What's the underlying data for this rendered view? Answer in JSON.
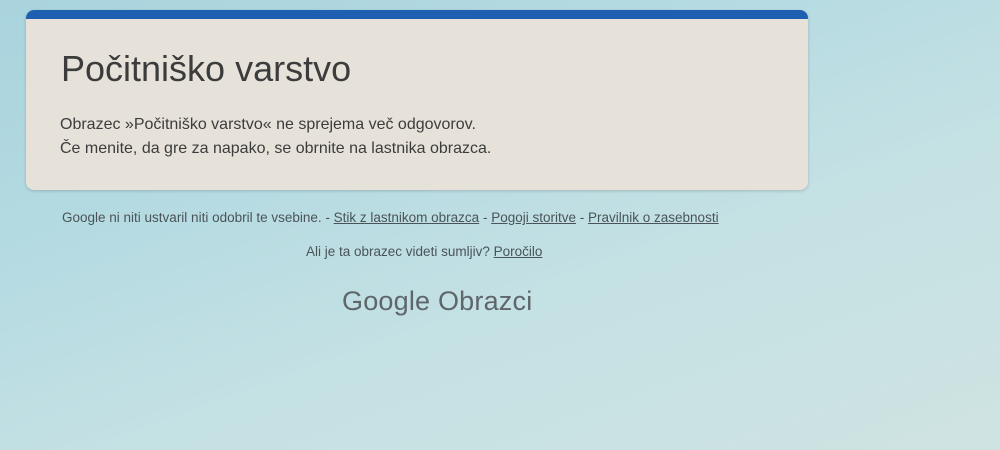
{
  "form": {
    "title": "Počitniško varstvo",
    "message_line1": "Obrazec »Počitniško varstvo« ne sprejema več odgovorov.",
    "message_line2": "Če menite, da gre za napako, se obrnite na lastnika obrazca."
  },
  "footer": {
    "disclaimer": "Google ni niti ustvaril niti odobril te vsebine.",
    "sep1": " - ",
    "contact_owner": "Stik z lastnikom obrazca",
    "sep2": " - ",
    "terms": "Pogoji storitve",
    "sep3": " - ",
    "privacy": "Pravilnik o zasebnosti",
    "report_question": "Ali je ta obrazec videti sumljiv?",
    "report_link": "Poročilo"
  },
  "brand": {
    "logo_text": "Google Obrazci"
  },
  "colors": {
    "accent": "#1f5fb1",
    "card_background": "#e6e2da",
    "page_background": "#b6dbe2",
    "text": "#3c3c3c"
  }
}
